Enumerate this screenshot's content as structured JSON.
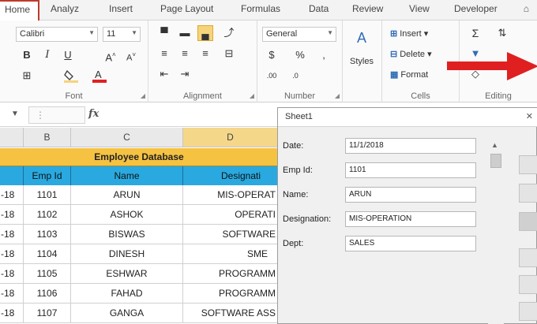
{
  "ribbon_tabs": [
    "Home",
    "Analyz",
    "Insert",
    "Page Layout",
    "Formulas",
    "Data",
    "Review",
    "View",
    "Developer"
  ],
  "ribbon": {
    "font_name": "Calibri",
    "font_size": "11",
    "number_format": "General",
    "groups": {
      "font": "Font",
      "alignment": "Alignment",
      "number": "Number",
      "cells": "Cells",
      "editing": "Editing"
    },
    "styles_label": "Styles",
    "insert_label": "Insert",
    "delete_label": "Delete",
    "format_label": "Format",
    "highlight_color": "#f6d47c",
    "font_color": "#e02020"
  },
  "formula_bar": {
    "fx_label": "fx"
  },
  "grid": {
    "column_headers": [
      "B",
      "C",
      "D"
    ],
    "title": "Employee Database",
    "headers": [
      "Emp Id",
      "Name",
      "Designati"
    ],
    "rows": [
      {
        "stub": "-18",
        "emp_id": "1101",
        "name": "ARUN",
        "designation": "MIS-OPERAT"
      },
      {
        "stub": "-18",
        "emp_id": "1102",
        "name": "ASHOK",
        "designation": "OPERATI"
      },
      {
        "stub": "-18",
        "emp_id": "1103",
        "name": "BISWAS",
        "designation": "SOFTWARE"
      },
      {
        "stub": "-18",
        "emp_id": "1104",
        "name": "DINESH",
        "designation": "SME"
      },
      {
        "stub": "-18",
        "emp_id": "1105",
        "name": "ESHWAR",
        "designation": "PROGRAMM"
      },
      {
        "stub": "-18",
        "emp_id": "1106",
        "name": "FAHAD",
        "designation": "PROGRAMM"
      },
      {
        "stub": "-18",
        "emp_id": "1107",
        "name": "GANGA",
        "designation": "SOFTWARE ASS"
      }
    ],
    "title_color": "#f5c242",
    "header_color": "#29a9df"
  },
  "userform": {
    "title": "Sheet1",
    "fields": [
      {
        "label": "Date:",
        "value": "11/1/2018"
      },
      {
        "label": "Emp Id:",
        "value": "1101"
      },
      {
        "label": "Name:",
        "value": "ARUN"
      },
      {
        "label": "Designation:",
        "value": "MIS-OPERATION"
      },
      {
        "label": "Dept:",
        "value": "SALES"
      }
    ]
  },
  "annotation": {
    "arrow_color": "#e02020"
  }
}
